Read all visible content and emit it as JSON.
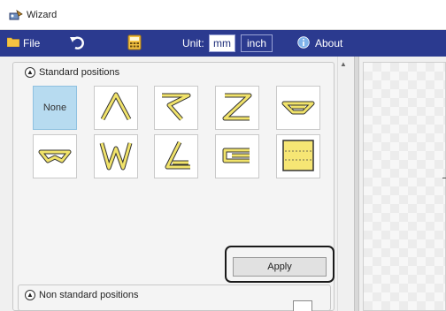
{
  "window": {
    "title": "Wizard",
    "icon": "wizard-app-icon"
  },
  "menubar": {
    "file_label": "File",
    "unit_label": "Unit:",
    "units": [
      "mm",
      "inch"
    ],
    "selected_unit": "mm",
    "about_label": "About",
    "colors": {
      "bar": "#2b3a8f",
      "icon_yellow": "#f5c342"
    }
  },
  "standard_positions": {
    "title": "Standard positions",
    "tiles": [
      {
        "id": "none",
        "label": "None",
        "selected": true
      },
      {
        "id": "caret"
      },
      {
        "id": "flag"
      },
      {
        "id": "z-fold"
      },
      {
        "id": "down-trapezoid"
      },
      {
        "id": "pinched"
      },
      {
        "id": "w-fold"
      },
      {
        "id": "l-angle"
      },
      {
        "id": "clip"
      },
      {
        "id": "square-fold"
      }
    ],
    "apply_label": "Apply"
  },
  "non_standard_positions": {
    "title": "Non standard positions"
  }
}
